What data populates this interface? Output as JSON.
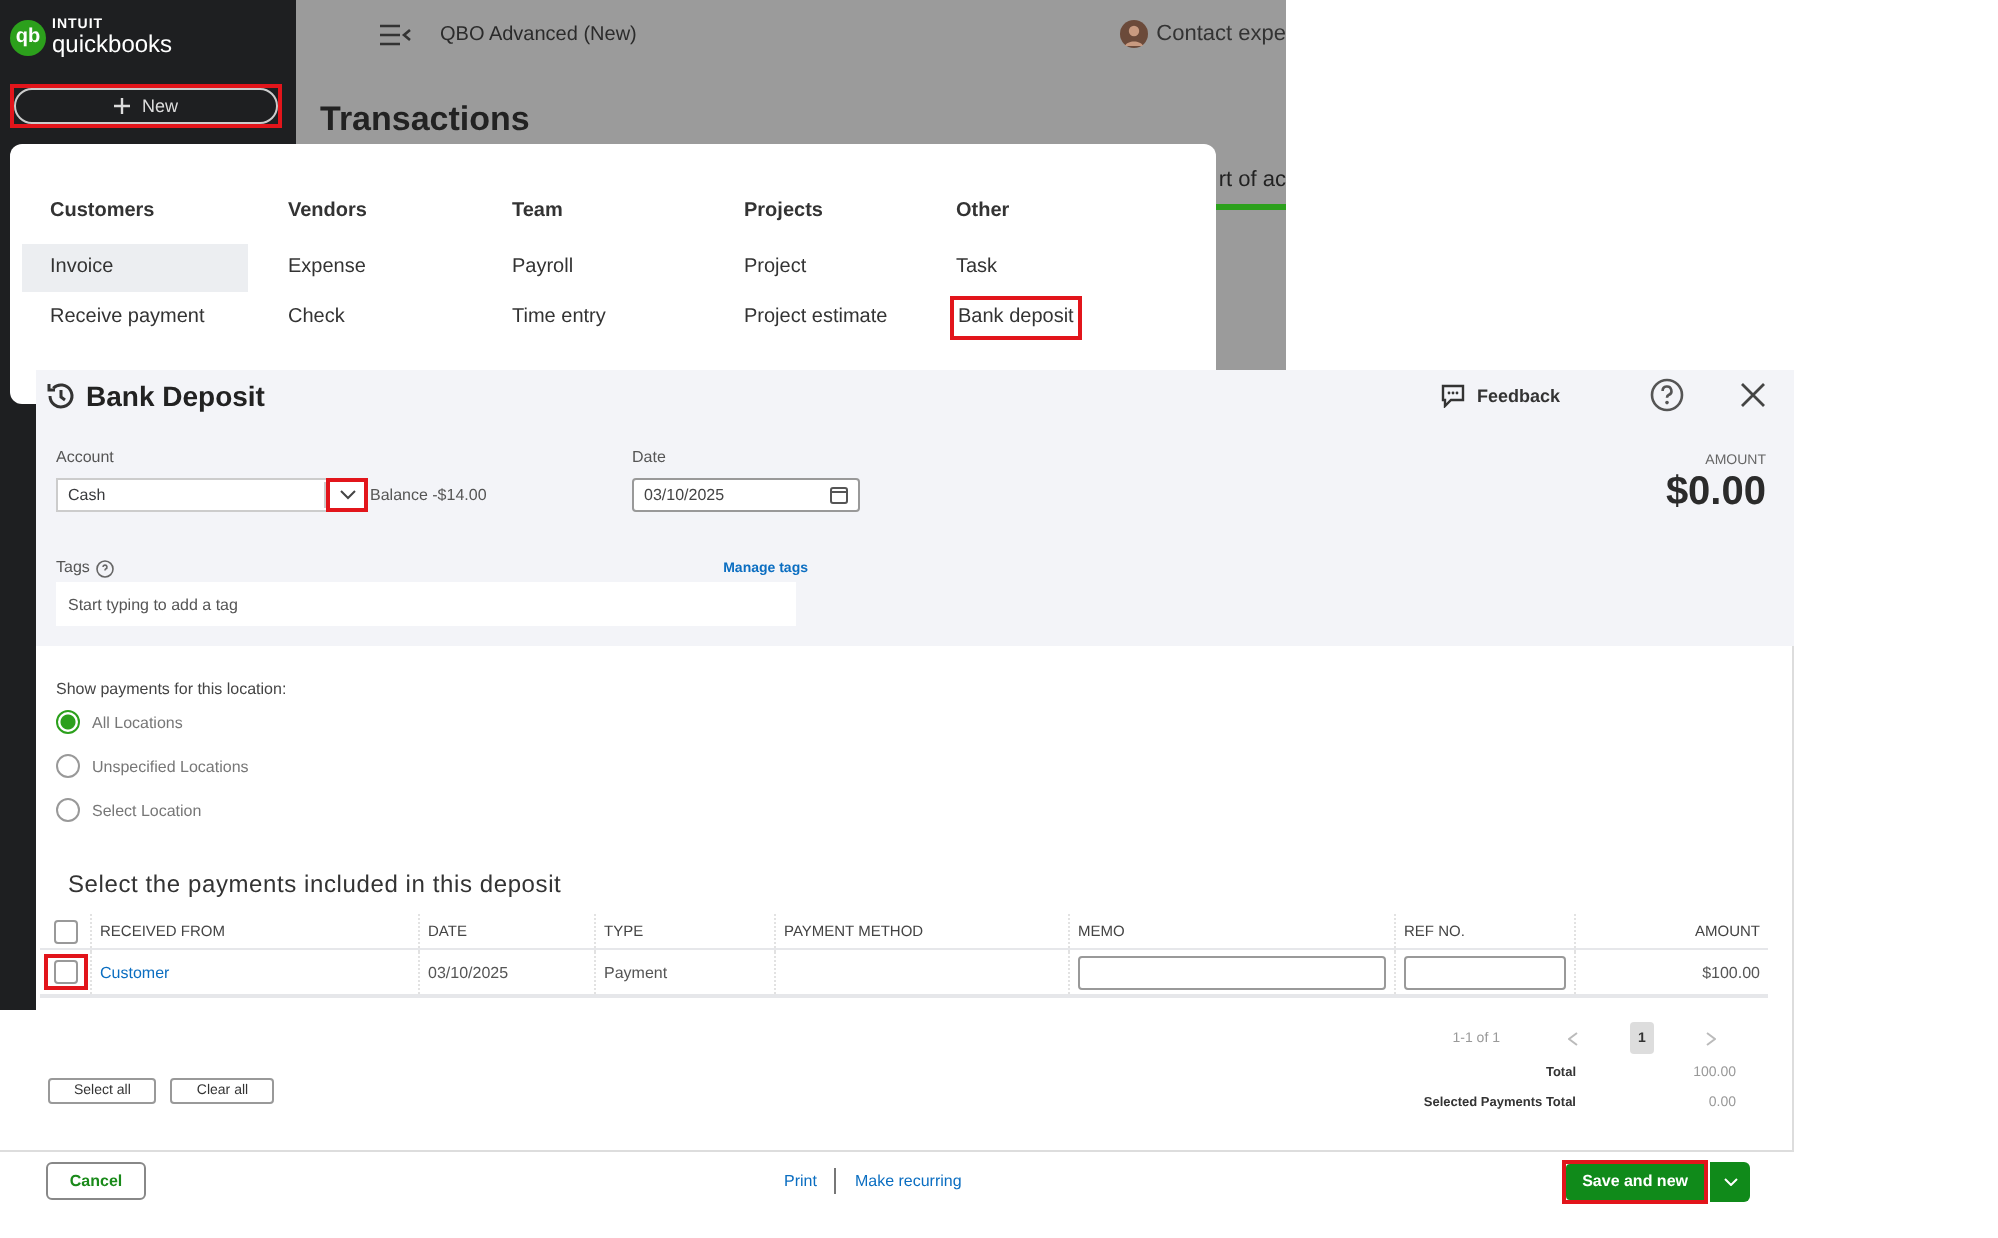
{
  "app": {
    "logo_mark": "qb",
    "logo_brand": "INTUIT",
    "logo_product": "quickbooks",
    "new_button": {
      "label": "New",
      "highlighted": true
    },
    "company": "QBO Advanced (New)",
    "contact": "Contact expe",
    "page_title": "Transactions",
    "clipped_link": "rt of ac"
  },
  "new_menu": {
    "columns": [
      {
        "heading": "Customers",
        "items": [
          {
            "label": "Invoice",
            "selected": true,
            "highlighted": false
          },
          {
            "label": "Receive payment",
            "selected": false,
            "highlighted": false
          }
        ]
      },
      {
        "heading": "Vendors",
        "items": [
          {
            "label": "Expense",
            "selected": false,
            "highlighted": false
          },
          {
            "label": "Check",
            "selected": false,
            "highlighted": false
          }
        ]
      },
      {
        "heading": "Team",
        "items": [
          {
            "label": "Payroll",
            "selected": false,
            "highlighted": false
          },
          {
            "label": "Time entry",
            "selected": false,
            "highlighted": false
          }
        ]
      },
      {
        "heading": "Projects",
        "items": [
          {
            "label": "Project",
            "selected": false,
            "highlighted": false
          },
          {
            "label": "Project estimate",
            "selected": false,
            "highlighted": false
          }
        ]
      },
      {
        "heading": "Other",
        "items": [
          {
            "label": "Task",
            "selected": false,
            "highlighted": false
          },
          {
            "label": "Bank deposit",
            "selected": false,
            "highlighted": true
          }
        ]
      }
    ]
  },
  "deposit": {
    "title": "Bank Deposit",
    "feedback": "Feedback",
    "account": {
      "label": "Account",
      "value": "Cash",
      "dropdown_highlighted": true,
      "balance": "Balance -$14.00"
    },
    "date": {
      "label": "Date",
      "value": "03/10/2025"
    },
    "amount": {
      "label": "AMOUNT",
      "value": "$0.00"
    },
    "tags": {
      "label": "Tags",
      "manage": "Manage tags",
      "placeholder": "Start typing to add a tag"
    },
    "location": {
      "label": "Show payments for this location:",
      "options": [
        {
          "label": "All Locations",
          "selected": true
        },
        {
          "label": "Unspecified Locations",
          "selected": false
        },
        {
          "label": "Select Location",
          "selected": false
        }
      ]
    },
    "payments": {
      "heading": "Select the payments included in this deposit",
      "all_checked": false,
      "columns": [
        {
          "label": "RECEIVED FROM",
          "kind": "link"
        },
        {
          "label": "DATE",
          "kind": "text"
        },
        {
          "label": "TYPE",
          "kind": "text"
        },
        {
          "label": "PAYMENT METHOD",
          "kind": "text"
        },
        {
          "label": "MEMO",
          "kind": "input"
        },
        {
          "label": "REF NO.",
          "kind": "input"
        },
        {
          "label": "AMOUNT",
          "kind": "amount"
        }
      ],
      "rows": [
        {
          "received_from": "Customer",
          "date": "03/10/2025",
          "type": "Payment",
          "amount": "$100.00",
          "checked": false,
          "highlighted": true
        }
      ]
    },
    "pagination": {
      "range": "1-1 of 1",
      "pages": [
        {
          "label": "1",
          "selected": true
        }
      ]
    },
    "totals": [
      {
        "label": "Total",
        "value": "100.00"
      },
      {
        "label": "Selected Payments Total",
        "value": "0.00"
      }
    ],
    "bulk_buttons": [
      "Select all",
      "Clear all"
    ],
    "footer": {
      "cancel": "Cancel",
      "links": [
        "Print",
        "Make recurring"
      ],
      "save": {
        "label": "Save and new",
        "highlighted": true
      }
    }
  }
}
